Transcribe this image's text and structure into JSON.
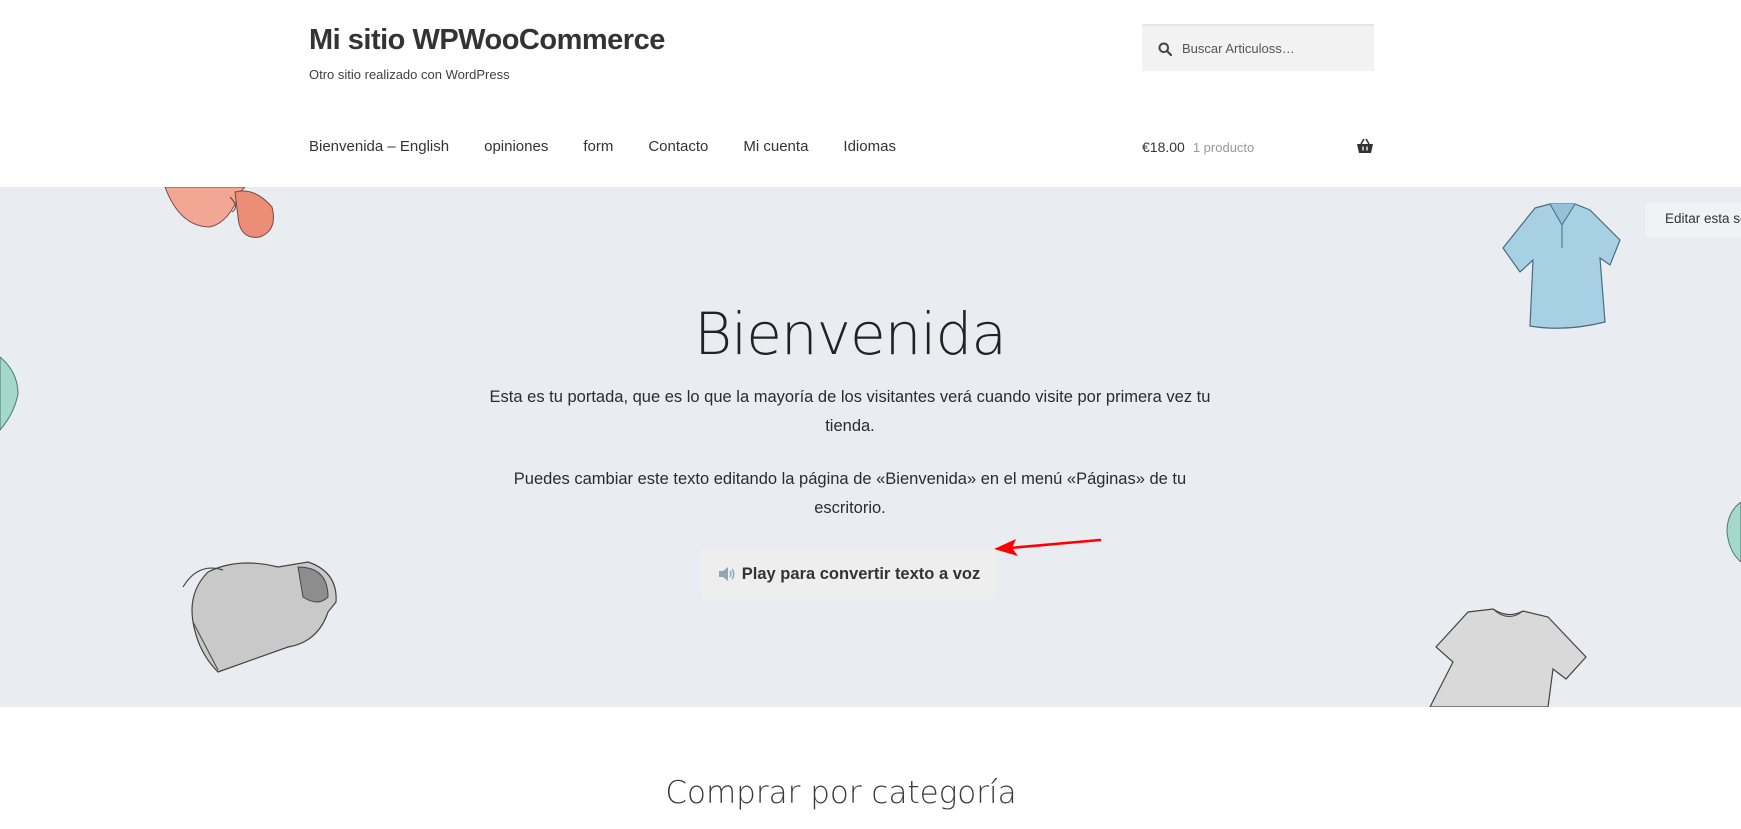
{
  "header": {
    "site_title": "Mi sitio WPWooCommerce",
    "tagline": "Otro sitio realizado con WordPress",
    "search": {
      "placeholder": "Buscar Articuloss…",
      "icon": "search-icon"
    }
  },
  "nav": {
    "items": [
      {
        "label": "Bienvenida – English"
      },
      {
        "label": "opiniones"
      },
      {
        "label": "form"
      },
      {
        "label": "Contacto"
      },
      {
        "label": "Mi cuenta"
      },
      {
        "label": "Idiomas"
      }
    ]
  },
  "cart": {
    "total": "€18.00",
    "count": "1 producto",
    "icon": "basket-icon"
  },
  "hero": {
    "title": "Bienvenida",
    "paragraph_1": "Esta es tu portada, que es lo que la mayoría de los visitantes verá cuando visite por primera vez tu tienda.",
    "paragraph_2": "Puedes cambiar este texto editando la página de «Bienvenida» en el menú «Páginas» de tu escritorio.",
    "play_button": "Play para convertir texto a voz",
    "play_icon": "speaker-icon",
    "edit_link": "Editar esta se",
    "background_color": "#e9edf1"
  },
  "annotation": {
    "arrow_color": "#ff0000"
  },
  "section": {
    "title": "Comprar por categoría"
  }
}
